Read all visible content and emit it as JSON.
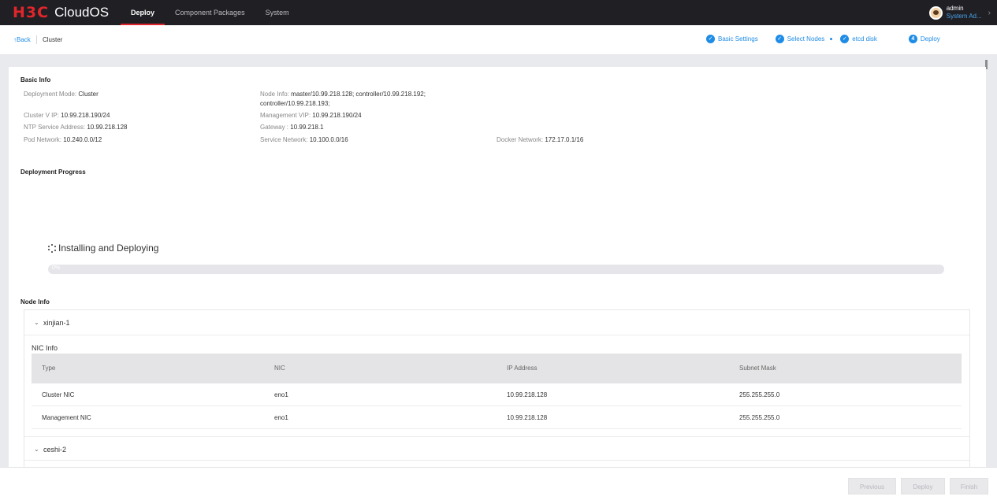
{
  "brand": {
    "logo_mark": "H3C",
    "product": "CloudOS"
  },
  "nav": {
    "items": [
      "Deploy",
      "Component Packages",
      "System"
    ],
    "active": "Deploy"
  },
  "user": {
    "name": "admin",
    "role": "System Ad..."
  },
  "subheader": {
    "back_label": "Back",
    "breadcrumb": "Cluster",
    "steps": [
      {
        "label": "Basic Settings",
        "state": "done"
      },
      {
        "label": "Select Nodes",
        "state": "done"
      },
      {
        "label": "etcd disk",
        "state": "done"
      },
      {
        "label": "Deploy",
        "state": "current",
        "number": "4"
      }
    ]
  },
  "basic_info": {
    "title": "Basic Info",
    "deployment_mode": {
      "label": "Deployment Mode:",
      "value": "Cluster"
    },
    "node_info": {
      "label": "Node Info:",
      "value": "master/10.99.218.128; controller/10.99.218.192; controller/10.99.218.193;"
    },
    "cluster_vip": {
      "label": "Cluster V IP:",
      "value": "10.99.218.190/24"
    },
    "management_vip": {
      "label": "Management VIP:",
      "value": "10.99.218.190/24"
    },
    "ntp": {
      "label": "NTP Service Address:",
      "value": "10.99.218.128"
    },
    "gateway": {
      "label": "Gateway :",
      "value": "10.99.218.1"
    },
    "pod_network": {
      "label": "Pod Network:",
      "value": "10.240.0.0/12"
    },
    "service_network": {
      "label": "Service Network:",
      "value": "10.100.0.0/16"
    },
    "docker_network": {
      "label": "Docker Network:",
      "value": "172.17.0.1/16"
    }
  },
  "progress": {
    "title": "Deployment Progress",
    "status": "Installing and Deploying",
    "percent_label": "0%",
    "percent": 0
  },
  "node_info": {
    "title": "Node Info",
    "nodes": [
      {
        "name": "xinjian-1",
        "nic_title": "NIC Info",
        "columns": [
          "Type",
          "NIC",
          "IP Address",
          "Subnet Mask"
        ],
        "rows": [
          [
            "Cluster NIC",
            "eno1",
            "10.99.218.128",
            "255.255.255.0"
          ],
          [
            "Management NIC",
            "eno1",
            "10.99.218.128",
            "255.255.255.0"
          ]
        ]
      },
      {
        "name": "ceshi-2"
      }
    ]
  },
  "footer": {
    "previous": "Previous",
    "deploy": "Deploy",
    "finish": "Finish"
  },
  "colors": {
    "accent": "#1e8ce6",
    "brand_red": "#e0262c",
    "topbar": "#1f1f24"
  }
}
